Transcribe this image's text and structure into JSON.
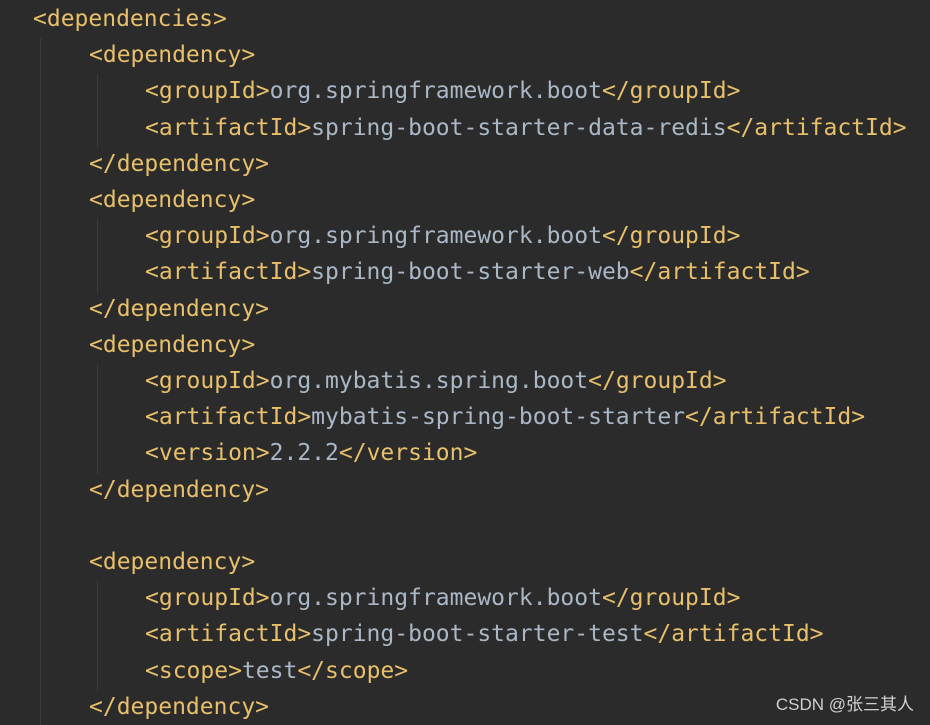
{
  "colors": {
    "background": "#2b2b2b",
    "tag": "#e8bf6a",
    "text": "#a9b7c6",
    "indent_guide": "#3c3c3c"
  },
  "lines": [
    {
      "indent": 0,
      "parts": [
        {
          "t": "tag",
          "v": "<dependencies>"
        }
      ]
    },
    {
      "indent": 1,
      "parts": [
        {
          "t": "tag",
          "v": "<dependency>"
        }
      ]
    },
    {
      "indent": 2,
      "parts": [
        {
          "t": "tag",
          "v": "<groupId>"
        },
        {
          "t": "txt",
          "v": "org.springframework.boot"
        },
        {
          "t": "tag",
          "v": "</groupId>"
        }
      ]
    },
    {
      "indent": 2,
      "parts": [
        {
          "t": "tag",
          "v": "<artifactId>"
        },
        {
          "t": "txt",
          "v": "spring-boot-starter-data-redis"
        },
        {
          "t": "tag",
          "v": "</artifactId>"
        }
      ]
    },
    {
      "indent": 1,
      "parts": [
        {
          "t": "tag",
          "v": "</dependency>"
        }
      ]
    },
    {
      "indent": 1,
      "parts": [
        {
          "t": "tag",
          "v": "<dependency>"
        }
      ]
    },
    {
      "indent": 2,
      "parts": [
        {
          "t": "tag",
          "v": "<groupId>"
        },
        {
          "t": "txt",
          "v": "org.springframework.boot"
        },
        {
          "t": "tag",
          "v": "</groupId>"
        }
      ]
    },
    {
      "indent": 2,
      "parts": [
        {
          "t": "tag",
          "v": "<artifactId>"
        },
        {
          "t": "txt",
          "v": "spring-boot-starter-web"
        },
        {
          "t": "tag",
          "v": "</artifactId>"
        }
      ]
    },
    {
      "indent": 1,
      "parts": [
        {
          "t": "tag",
          "v": "</dependency>"
        }
      ]
    },
    {
      "indent": 1,
      "parts": [
        {
          "t": "tag",
          "v": "<dependency>"
        }
      ]
    },
    {
      "indent": 2,
      "parts": [
        {
          "t": "tag",
          "v": "<groupId>"
        },
        {
          "t": "txt",
          "v": "org.mybatis.spring.boot"
        },
        {
          "t": "tag",
          "v": "</groupId>"
        }
      ]
    },
    {
      "indent": 2,
      "parts": [
        {
          "t": "tag",
          "v": "<artifactId>"
        },
        {
          "t": "txt",
          "v": "mybatis-spring-boot-starter"
        },
        {
          "t": "tag",
          "v": "</artifactId>"
        }
      ]
    },
    {
      "indent": 2,
      "parts": [
        {
          "t": "tag",
          "v": "<version>"
        },
        {
          "t": "txt",
          "v": "2.2.2"
        },
        {
          "t": "tag",
          "v": "</version>"
        }
      ]
    },
    {
      "indent": 1,
      "parts": [
        {
          "t": "tag",
          "v": "</dependency>"
        }
      ]
    },
    {
      "indent": 0,
      "parts": []
    },
    {
      "indent": 1,
      "parts": [
        {
          "t": "tag",
          "v": "<dependency>"
        }
      ]
    },
    {
      "indent": 2,
      "parts": [
        {
          "t": "tag",
          "v": "<groupId>"
        },
        {
          "t": "txt",
          "v": "org.springframework.boot"
        },
        {
          "t": "tag",
          "v": "</groupId>"
        }
      ]
    },
    {
      "indent": 2,
      "parts": [
        {
          "t": "tag",
          "v": "<artifactId>"
        },
        {
          "t": "txt",
          "v": "spring-boot-starter-test"
        },
        {
          "t": "tag",
          "v": "</artifactId>"
        }
      ]
    },
    {
      "indent": 2,
      "parts": [
        {
          "t": "tag",
          "v": "<scope>"
        },
        {
          "t": "txt",
          "v": "test"
        },
        {
          "t": "tag",
          "v": "</scope>"
        }
      ]
    },
    {
      "indent": 1,
      "parts": [
        {
          "t": "tag",
          "v": "</dependency>"
        }
      ]
    }
  ],
  "watermark": "CSDN @张三其人"
}
